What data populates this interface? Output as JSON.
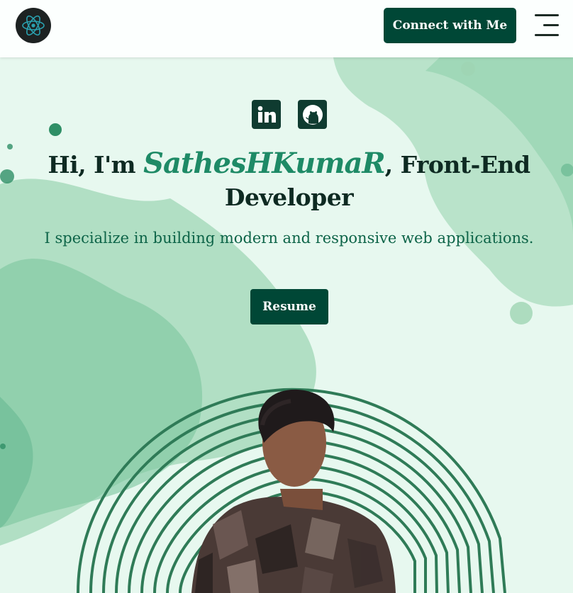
{
  "navbar": {
    "logo_icon": "react-atom-icon",
    "connect_label": "Connect with Me",
    "menu_icon": "hamburger-menu-icon"
  },
  "social": {
    "linkedin_icon": "linkedin-icon",
    "github_icon": "github-icon"
  },
  "hero": {
    "greeting_prefix": "Hi, I'm",
    "name": "SathesHKumaR",
    "greeting_suffix": ", Front-End Developer",
    "tagline": "I specialize in building modern and responsive web applications.",
    "resume_label": "Resume"
  },
  "colors": {
    "primary": "#004736",
    "accent": "#1e8a66",
    "background": "#e6f7ee",
    "text_dark": "#0e2a22"
  }
}
